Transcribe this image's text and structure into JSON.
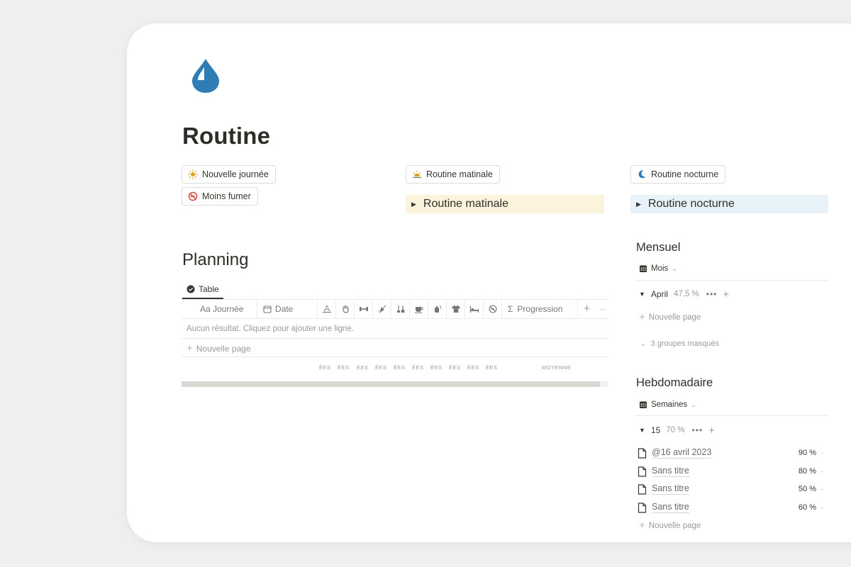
{
  "page": {
    "title": "Routine",
    "icon": "water-drop-icon",
    "accent": "#2e7db5"
  },
  "buttons": {
    "nouvelle_journee": "Nouvelle journée",
    "moins_fumer": "Moins fumer",
    "routine_matinale": "Routine matinale",
    "routine_nocturne": "Routine nocturne"
  },
  "toggles": {
    "matinale": {
      "label": "Routine matinale",
      "bg": "#fbf3db"
    },
    "nocturne": {
      "label": "Routine nocturne",
      "bg": "#e7f3f8"
    }
  },
  "planning": {
    "heading": "Planning",
    "tab_label": "Table",
    "columns": {
      "journee": "Aa Journée",
      "date": "Date",
      "progression": "Progression"
    },
    "habit_icons": [
      "sunrise-icon",
      "hand-icon",
      "dumbbell-icon",
      "shower-icon",
      "cleaning-icon",
      "coffee-cup-icon",
      "soap-icon",
      "tshirt-icon",
      "bed-icon",
      "no-smoking-icon"
    ],
    "empty_message": "Aucun résultat. Cliquez pour ajouter une ligne.",
    "new_page": "Nouvelle page",
    "calc_labels": [
      "ÉES",
      "ÉES",
      "ÉES",
      "ÉES",
      "ÉES",
      "ÉES",
      "ÉES",
      "ÉES",
      "ÉES",
      "ÉES"
    ],
    "calc_avg": "MOYENNE"
  },
  "mensuel": {
    "heading": "Mensuel",
    "view_label": "Mois",
    "group": {
      "name": "April",
      "pct": "47,5 %"
    },
    "new_page": "Nouvelle page",
    "hidden_groups": "3 groupes masqués"
  },
  "hebdo": {
    "heading": "Hebdomadaire",
    "view_label": "Semaines",
    "group": {
      "name": "15",
      "pct": "70 %"
    },
    "items": [
      {
        "name": "@16 avril 2023",
        "value": "90 %"
      },
      {
        "name": "Sans titre",
        "value": "80 %"
      },
      {
        "name": "Sans titre",
        "value": "50 %"
      },
      {
        "name": "Sans titre",
        "value": "60 %"
      }
    ],
    "new_page": "Nouvelle page"
  }
}
